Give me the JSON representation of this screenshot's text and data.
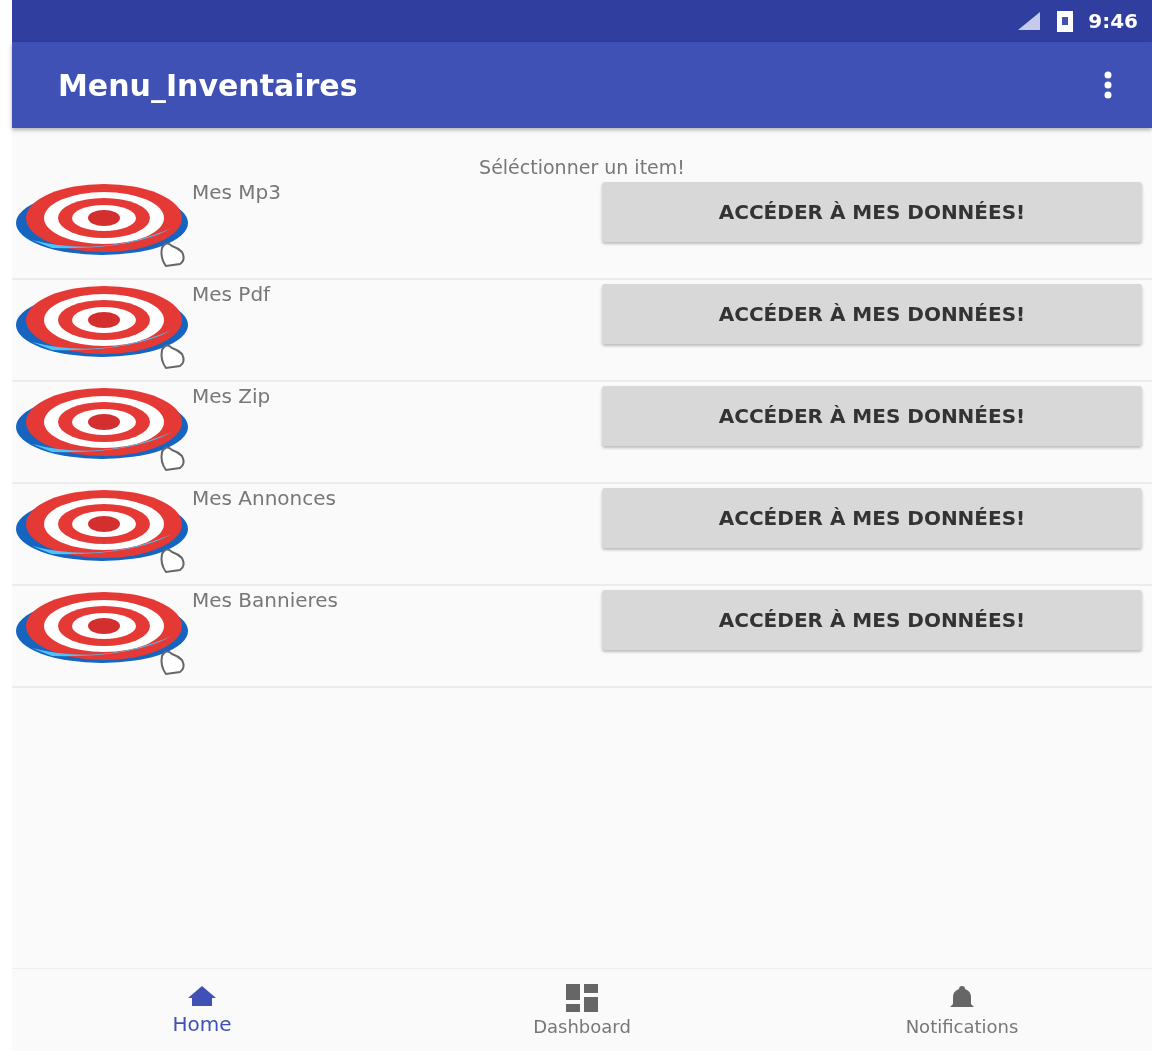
{
  "status_bar": {
    "time": "9:46"
  },
  "app_bar": {
    "title": "Menu_Inventaires"
  },
  "prompt": "Séléctionner un item!",
  "items": [
    {
      "title": "Mes Mp3",
      "button": "ACCÉDER À MES DONNÉES!"
    },
    {
      "title": "Mes Pdf",
      "button": "ACCÉDER À MES DONNÉES!"
    },
    {
      "title": "Mes Zip",
      "button": "ACCÉDER À MES DONNÉES!"
    },
    {
      "title": "Mes Annonces",
      "button": "ACCÉDER À MES DONNÉES!"
    },
    {
      "title": "Mes Bannieres",
      "button": "ACCÉDER À MES DONNÉES!"
    }
  ],
  "bottom_nav": [
    {
      "label": "Home",
      "kind": "home",
      "selected": true
    },
    {
      "label": "Dashboard",
      "kind": "dashboard",
      "selected": false
    },
    {
      "label": "Notifications",
      "kind": "notifications",
      "selected": false
    }
  ]
}
